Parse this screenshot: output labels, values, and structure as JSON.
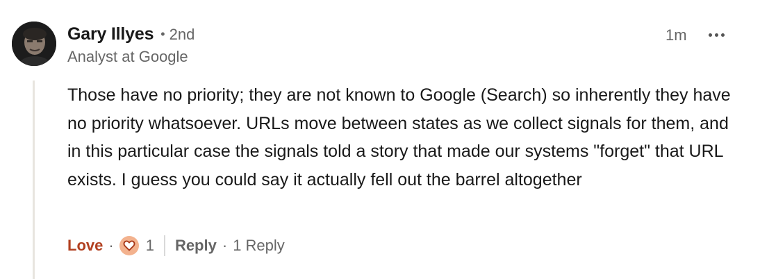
{
  "comment": {
    "author": {
      "name": "Gary Illyes",
      "degree_separator": "•",
      "degree": "2nd",
      "headline": "Analyst at Google"
    },
    "timestamp": "1m",
    "more_icon": "ellipsis-icon",
    "body": "Those have no priority; they are not known to Google (Search) so inherently they have no priority whatsoever. URLs move between states as we collect signals for them, and in this particular case the signals told a story that made our systems \"forget\" that URL exists. I guess you could say it actually fell out the barrel altogether",
    "actions": {
      "love_label": "Love",
      "dot": "·",
      "reaction_icon": "heart-reaction-icon",
      "reaction_count": "1",
      "reply_label": "Reply",
      "reply_count_label": "1 Reply"
    }
  },
  "colors": {
    "love_accent": "#b24020",
    "reaction_bg": "#f3b28e",
    "thread_line": "#e8e5df",
    "secondary_text": "#666666"
  }
}
